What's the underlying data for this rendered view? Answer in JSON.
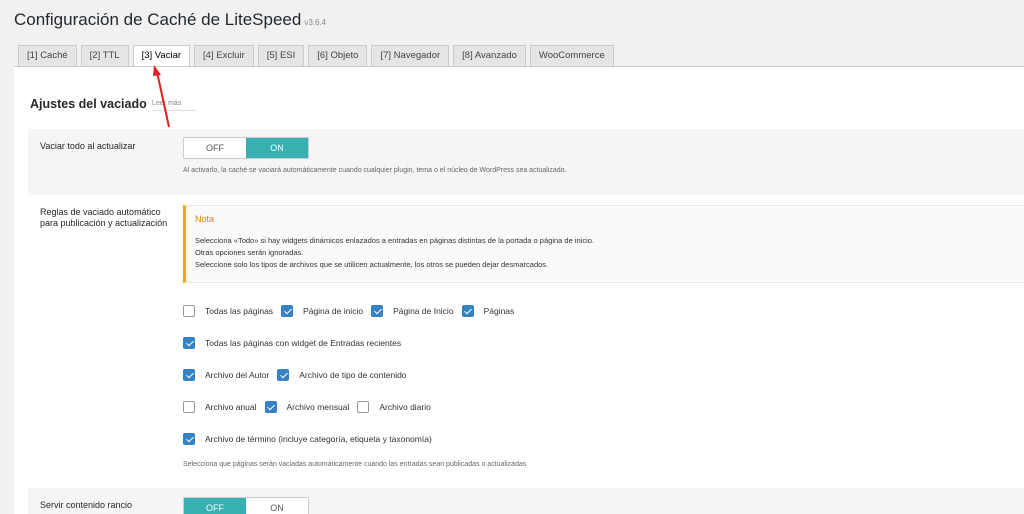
{
  "page": {
    "title": "Configuración de Caché de LiteSpeed",
    "version": "v3.6.4"
  },
  "tabs": [
    {
      "label": "[1] Caché",
      "active": false
    },
    {
      "label": "[2] TTL",
      "active": false
    },
    {
      "label": "[3] Vaciar",
      "active": true
    },
    {
      "label": "[4] Excluir",
      "active": false
    },
    {
      "label": "[5] ESI",
      "active": false
    },
    {
      "label": "[6] Objeto",
      "active": false
    },
    {
      "label": "[7] Navegador",
      "active": false
    },
    {
      "label": "[8] Avanzado",
      "active": false
    },
    {
      "label": "WooCommerce",
      "active": false
    }
  ],
  "section": {
    "title": "Ajustes del vaciado",
    "learn_more": "Leer más"
  },
  "purge_all_on_upgrade": {
    "label": "Vaciar todo al actualizar",
    "off_label": "OFF",
    "on_label": "ON",
    "value": "ON",
    "hint": "Al activarlo, la caché se vaciará automáticamente cuando cualquier plugin, tema o el núcleo de WordPress sea actualizado."
  },
  "auto_purge_rules": {
    "label": "Reglas de vaciado automático para publicación y actualización",
    "note_title": "Nota",
    "note_lines": [
      "Selecciona «Todo» si hay widgets dinámicos enlazados a entradas en páginas distintas de la portada o página de inicio.",
      "Otras opciones serán ignoradas.",
      "Seleccione solo los tipos de archivos que se utilicen actualmente, los otros se pueden dejar desmarcados."
    ],
    "options": {
      "all_pages": {
        "label": "Todas las páginas",
        "checked": false
      },
      "front_page": {
        "label": "Página de inicio",
        "checked": true
      },
      "home_page": {
        "label": "Página de Inicio",
        "checked": true
      },
      "pages": {
        "label": "Páginas",
        "checked": true
      },
      "recent_posts_widget": {
        "label": "Todas las páginas con widget de Entradas recientes",
        "checked": true
      },
      "author_archive": {
        "label": "Archivo del Autor",
        "checked": true
      },
      "post_type_archive": {
        "label": "Archivo de tipo de contenido",
        "checked": true
      },
      "yearly_archive": {
        "label": "Archivo anual",
        "checked": false
      },
      "monthly_archive": {
        "label": "Archivo mensual",
        "checked": true
      },
      "daily_archive": {
        "label": "Archivo diario",
        "checked": false
      },
      "term_archive": {
        "label": "Archivo de término (incluye categoría, etiqueta y taxonomía)",
        "checked": true
      }
    },
    "hint": "Selecciona que páginas serán vaciadas automáticamente cuando las entradas sean publicadas o actualizadas"
  },
  "serve_stale": {
    "label": "Servir contenido rancio",
    "off_label": "OFF",
    "on_label": "ON",
    "value": "OFF"
  },
  "colors": {
    "accent": "#36b0b0",
    "checkbox": "#3582c4",
    "note_border": "#f0a700",
    "annotation_arrow": "#e02020"
  }
}
